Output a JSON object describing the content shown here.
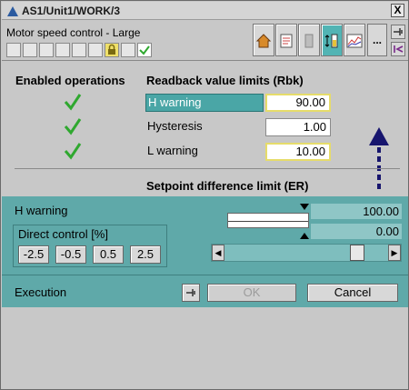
{
  "window": {
    "title": "AS1/Unit1/WORK/3",
    "close_label": "X"
  },
  "header": {
    "subtitle": "Motor speed control - Large"
  },
  "toolbar": {
    "more_label": "..."
  },
  "enabled_operations": {
    "heading": "Enabled operations"
  },
  "readback_limits": {
    "heading": "Readback value limits (Rbk)",
    "rows": [
      {
        "label": "H warning",
        "value": "90.00"
      },
      {
        "label": "Hysteresis",
        "value": "1.00"
      },
      {
        "label": "L warning",
        "value": "10.00"
      }
    ]
  },
  "setpoint_limit": {
    "heading": "Setpoint difference limit (ER)"
  },
  "control": {
    "h_warning_label": "H warning",
    "upper_value": "100.00",
    "lower_value": "0.00",
    "direct_control_title": "Direct control [%]",
    "direct_buttons": [
      "-2.5",
      "-0.5",
      "0.5",
      "2.5"
    ],
    "slider_level": 0.84
  },
  "footer": {
    "execution_label": "Execution",
    "ok_label": "OK",
    "cancel_label": "Cancel"
  },
  "colors": {
    "teal_panel": "#5fa9a9",
    "selection": "#4aa6a6",
    "check_green": "#2fa82f",
    "arrow_navy": "#17156e"
  }
}
